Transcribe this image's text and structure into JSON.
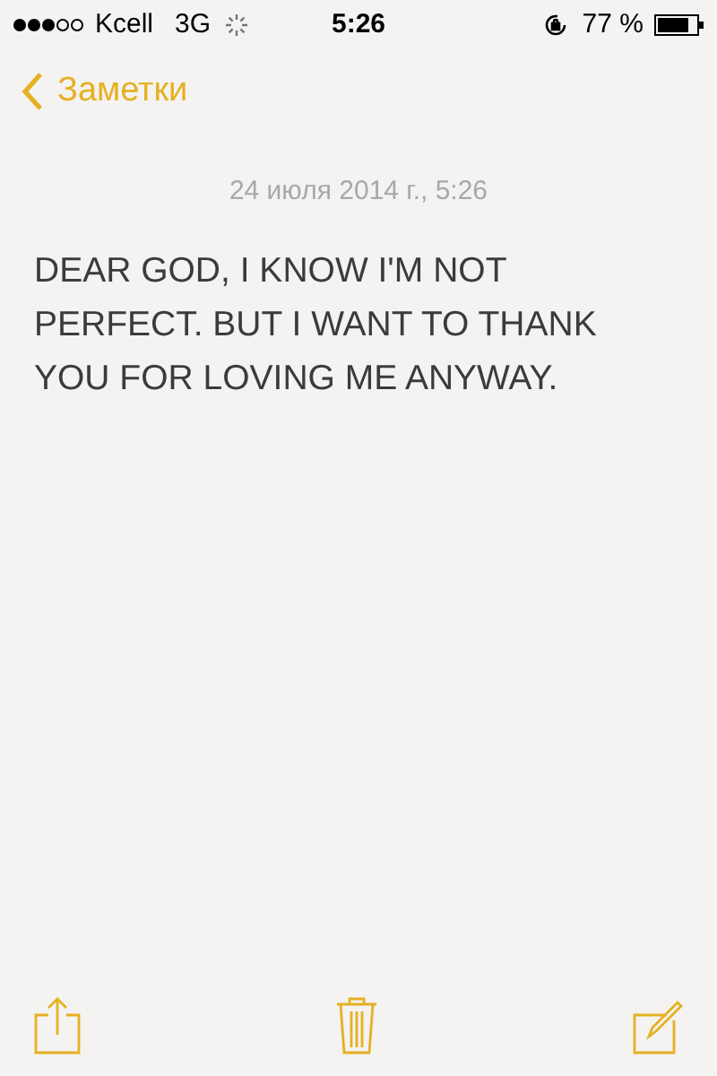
{
  "status_bar": {
    "carrier": "Kcell",
    "network": "3G",
    "time": "5:26",
    "battery": "77 %"
  },
  "nav": {
    "back": "Заметки"
  },
  "note": {
    "date": "24 июля 2014 г., 5:26",
    "text": "DEAR GOD, I KNOW I'M NOT PERFECT. BUT I WANT TO THANK YOU FOR LOVING ME ANYWAY."
  }
}
